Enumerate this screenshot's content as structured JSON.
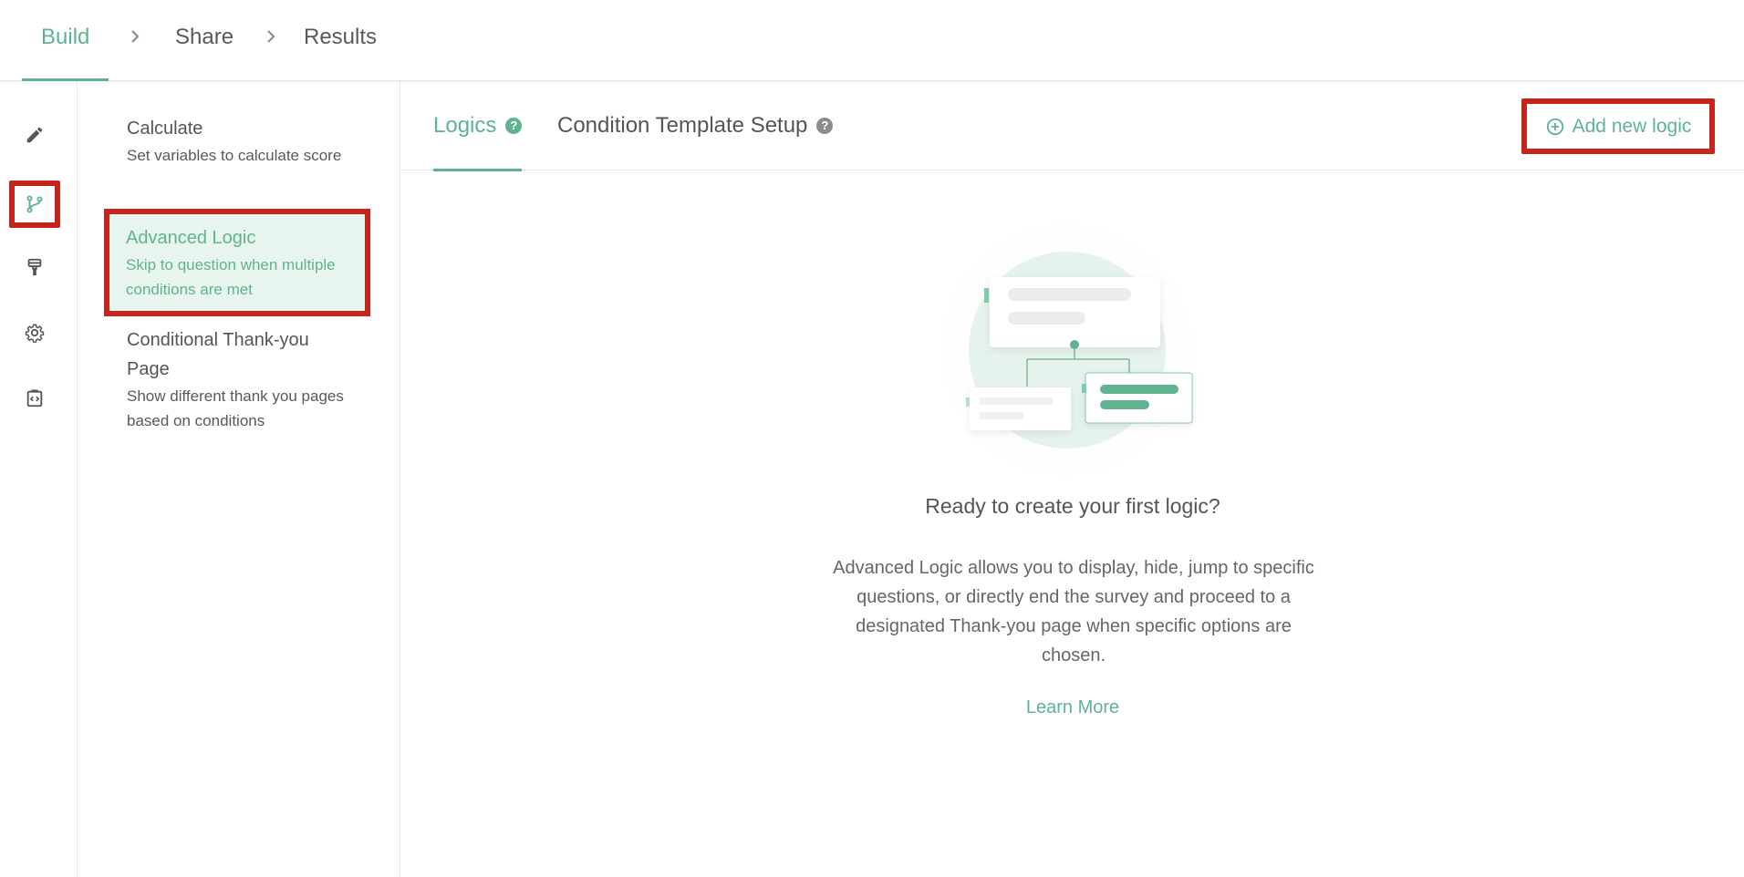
{
  "breadcrumb": [
    {
      "label": "Build",
      "active": true
    },
    {
      "label": "Share",
      "active": false
    },
    {
      "label": "Results",
      "active": false
    }
  ],
  "rail": [
    {
      "icon": "pencil-icon",
      "selected": false
    },
    {
      "icon": "branch-icon",
      "selected": true
    },
    {
      "icon": "paint-roller-icon",
      "selected": false
    },
    {
      "icon": "gear-icon",
      "selected": false
    },
    {
      "icon": "code-icon",
      "selected": false
    }
  ],
  "submenu": {
    "items": [
      {
        "title": "Calculate",
        "desc": "Set variables to calculate score"
      },
      {
        "title": "Advanced Logic",
        "desc": "Skip to question when multiple conditions are met",
        "active": true
      },
      {
        "title": "Conditional Thank-you Page",
        "desc": "Show different thank you pages based on conditions"
      }
    ]
  },
  "tabs": [
    {
      "label": "Logics",
      "help": "?",
      "active": true
    },
    {
      "label": "Condition Template Setup",
      "help": "?",
      "active": false
    }
  ],
  "add_button": {
    "label": "Add new logic",
    "icon": "plus-circle-icon"
  },
  "empty_state": {
    "title": "Ready to create your first logic?",
    "description": "Advanced Logic allows you to display, hide, jump to specific questions, or directly end the survey and proceed to a designated Thank-you page when specific options are chosen.",
    "link": "Learn More"
  },
  "colors": {
    "accent": "#5fb391",
    "highlight": "#c4261d",
    "text": "#555555"
  }
}
